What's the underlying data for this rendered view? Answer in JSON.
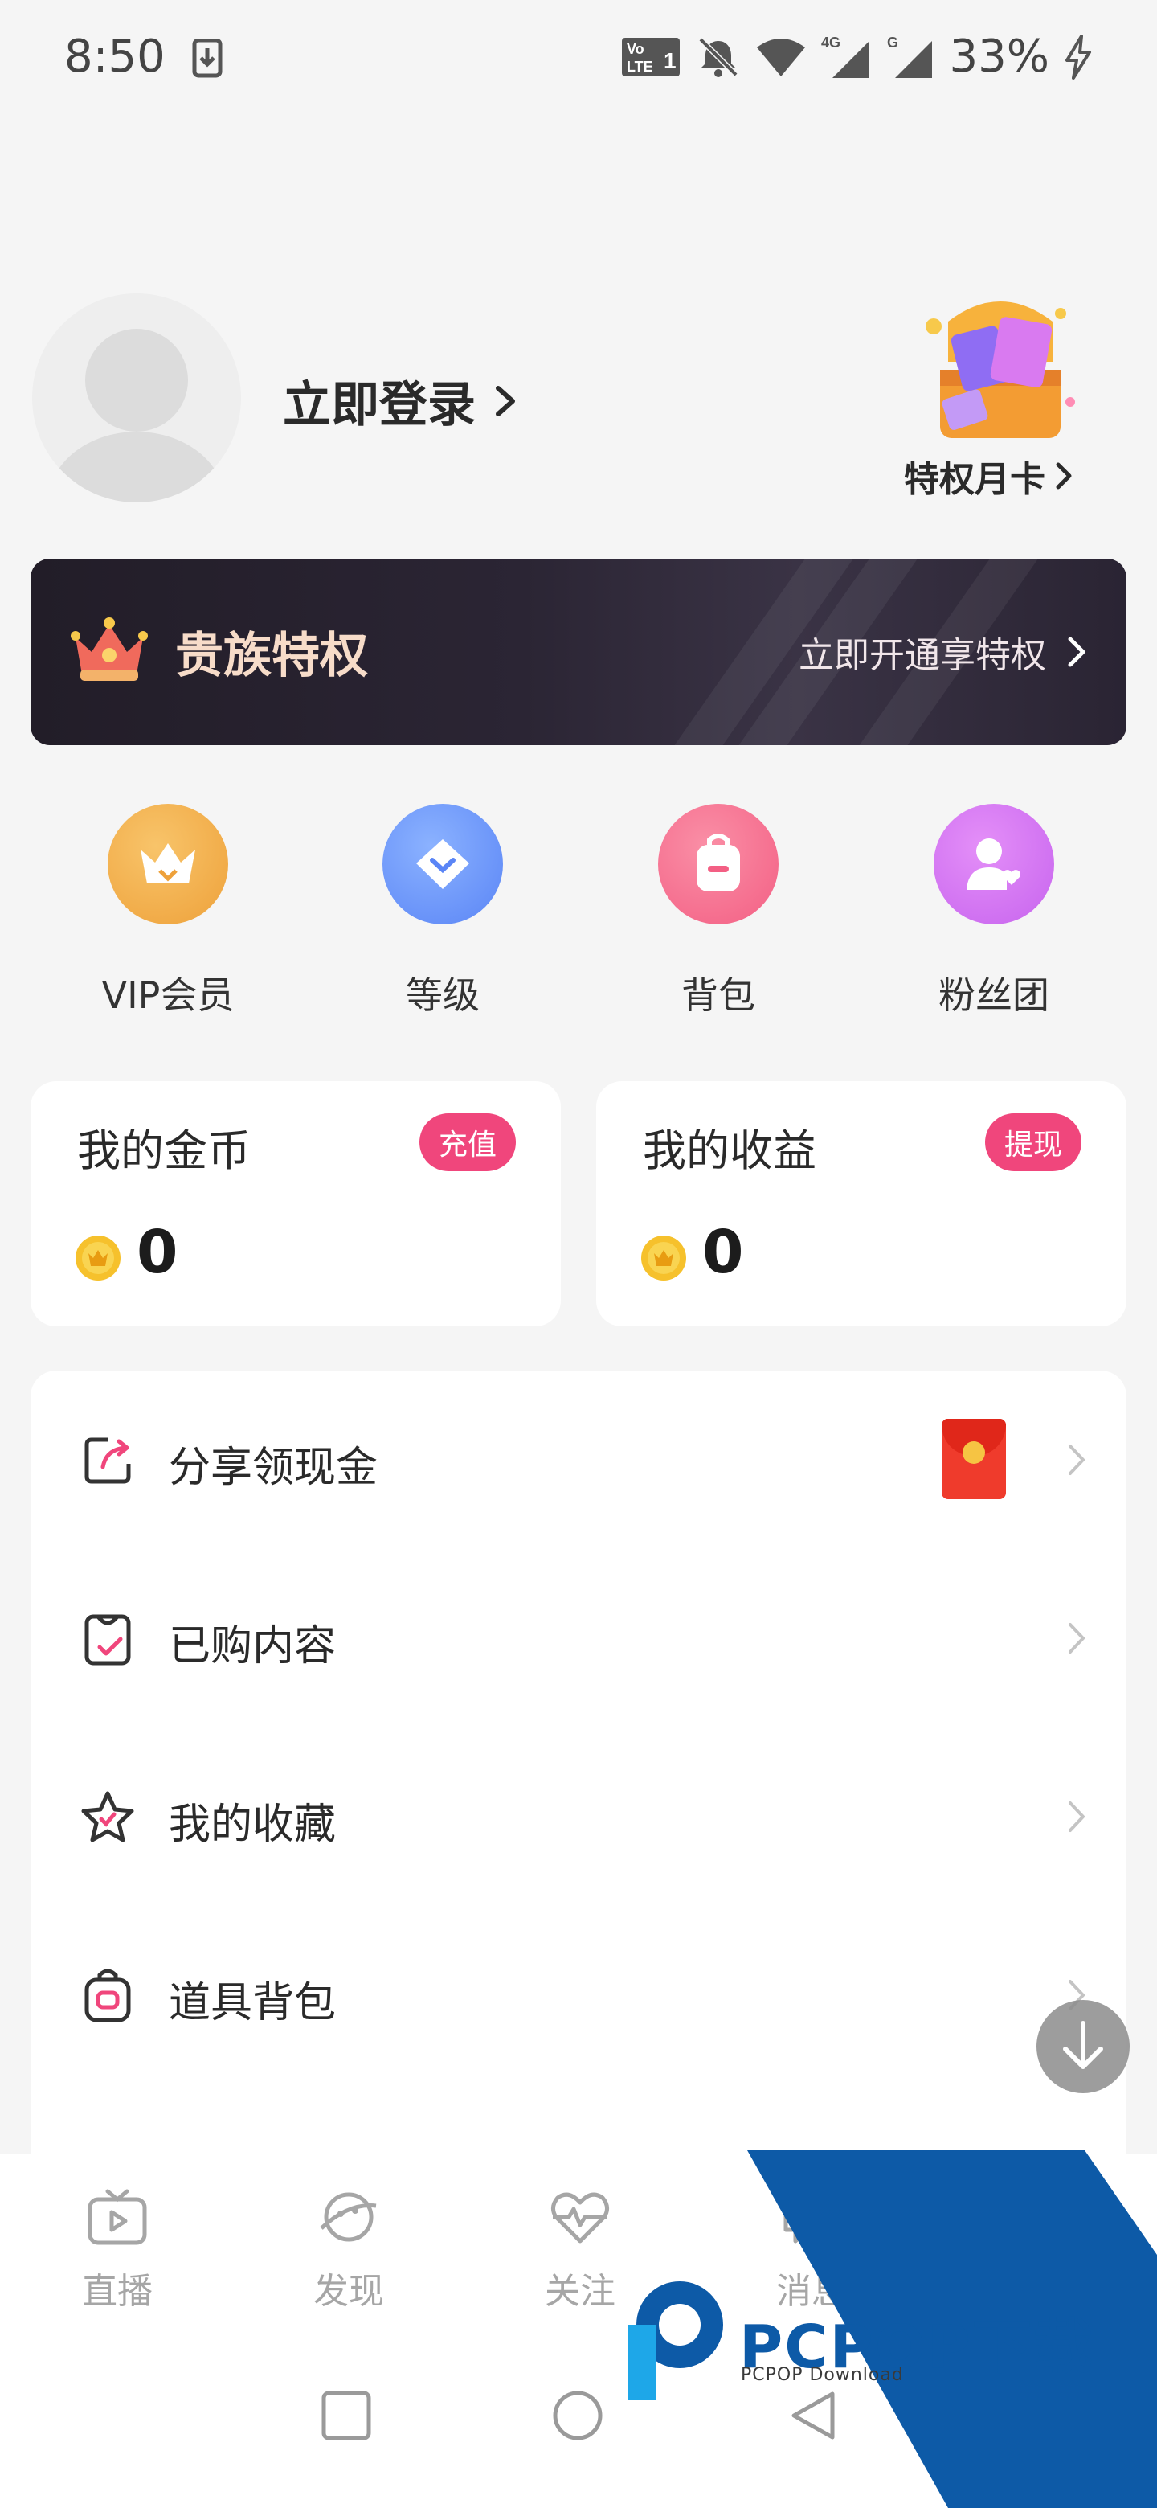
{
  "status_bar": {
    "time": "8:50",
    "battery": "33%"
  },
  "profile": {
    "login_label": "立即登录",
    "monthly_card_label": "特权月卡"
  },
  "noble_banner": {
    "title": "贵族特权",
    "cta": "立即开通享特权"
  },
  "quick_actions": [
    {
      "label": "VIP会员",
      "icon": "crown-icon",
      "color": "#f4b14c"
    },
    {
      "label": "等级",
      "icon": "diamond-icon",
      "color": "#6f98ff"
    },
    {
      "label": "背包",
      "icon": "backpack-icon",
      "color": "#f77494"
    },
    {
      "label": "粉丝团",
      "icon": "fan-user-icon",
      "color": "#d96ff0"
    }
  ],
  "wallet": {
    "coins": {
      "title": "我的金币",
      "badge": "充值",
      "value": "0"
    },
    "earnings": {
      "title": "我的收益",
      "badge": "提现",
      "value": "0"
    }
  },
  "menu": [
    {
      "label": "分享领现金",
      "icon": "share-icon"
    },
    {
      "label": "已购内容",
      "icon": "purchased-icon"
    },
    {
      "label": "我的收藏",
      "icon": "star-icon"
    },
    {
      "label": "道具背包",
      "icon": "backpack-icon"
    }
  ],
  "bottom_nav": [
    {
      "label": "直播",
      "icon": "tv-icon"
    },
    {
      "label": "发现",
      "icon": "planet-icon"
    },
    {
      "label": "关注",
      "icon": "heartbeat-icon"
    },
    {
      "label": "消息",
      "icon": "message-icon"
    }
  ],
  "watermark": {
    "title": "PCPOP下载",
    "subtitle": "PCPOP Download"
  },
  "colors": {
    "accent": "#f0467c",
    "banner": "#2a2433",
    "watermark_blue": "#0d5aa7"
  }
}
